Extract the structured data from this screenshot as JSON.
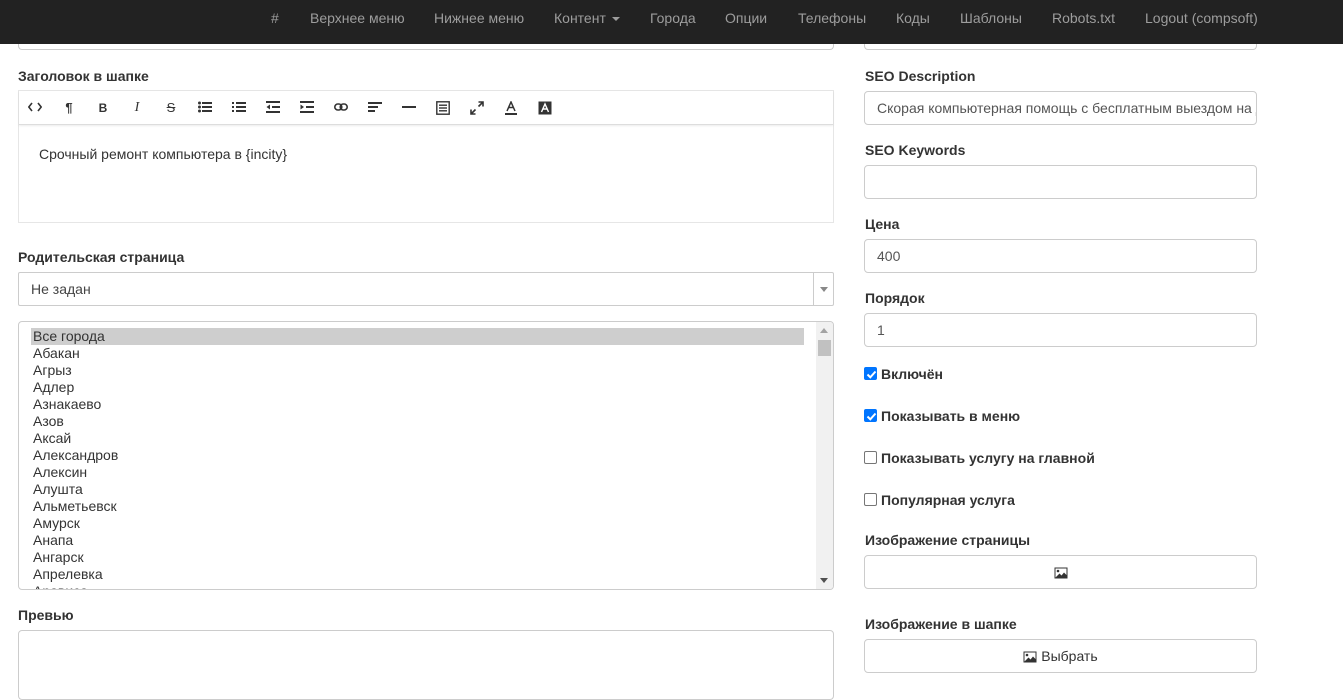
{
  "navbar": {
    "items": [
      {
        "label": "#"
      },
      {
        "label": "Верхнее меню"
      },
      {
        "label": "Нижнее меню"
      },
      {
        "label": "Контент"
      },
      {
        "label": "Города"
      },
      {
        "label": "Опции"
      },
      {
        "label": "Телефоны"
      },
      {
        "label": "Коды"
      },
      {
        "label": "Шаблоны"
      },
      {
        "label": "Robots.txt"
      },
      {
        "label": "Logout (compsoft)"
      }
    ]
  },
  "left": {
    "header_title_label": "Заголовок в шапке",
    "editor_content": "Срочный ремонт компьютера в {incity}",
    "editor_tools": [
      "code-view-icon",
      "paragraph-icon",
      "bold-icon",
      "italic-icon",
      "strikethrough-icon",
      "unordered-list-icon",
      "ordered-list-icon",
      "outdent-icon",
      "indent-icon",
      "link-icon",
      "align-left-icon",
      "horizontal-rule-icon",
      "format-icon",
      "fullscreen-icon",
      "text-color-icon",
      "background-color-icon"
    ],
    "parent_page_label": "Родительская страница",
    "parent_page_value": "Не задан",
    "cities": [
      "Все города",
      "Абакан",
      "Агрыз",
      "Адлер",
      "Азнакаево",
      "Азов",
      "Аксай",
      "Александров",
      "Алексин",
      "Алушта",
      "Альметьевск",
      "Амурск",
      "Анапа",
      "Ангарск",
      "Апрелевка",
      "Арависа"
    ],
    "cities_selected_index": 0,
    "preview_label": "Превью"
  },
  "right": {
    "seo_description_label": "SEO Description",
    "seo_description_value": "Скорая компьютерная помощь с бесплатным выездом на дом",
    "seo_keywords_label": "SEO Keywords",
    "seo_keywords_value": "",
    "price_label": "Цена",
    "price_value": "400",
    "order_label": "Порядок",
    "order_value": "1",
    "checkboxes": [
      {
        "label": "Включён",
        "checked": true
      },
      {
        "label": "Показывать в меню",
        "checked": true
      },
      {
        "label": "Показывать услугу на главной",
        "checked": false
      },
      {
        "label": "Популярная услуга",
        "checked": false
      }
    ],
    "page_image_label": "Изображение страницы",
    "header_image_label": "Изображение в шапке",
    "choose_button_label": "Выбрать"
  },
  "colors": {
    "navbar_bg": "#222222",
    "navbar_text": "#9d9d9d",
    "checkbox_accent": "#0075ff",
    "border": "#cccccc"
  }
}
